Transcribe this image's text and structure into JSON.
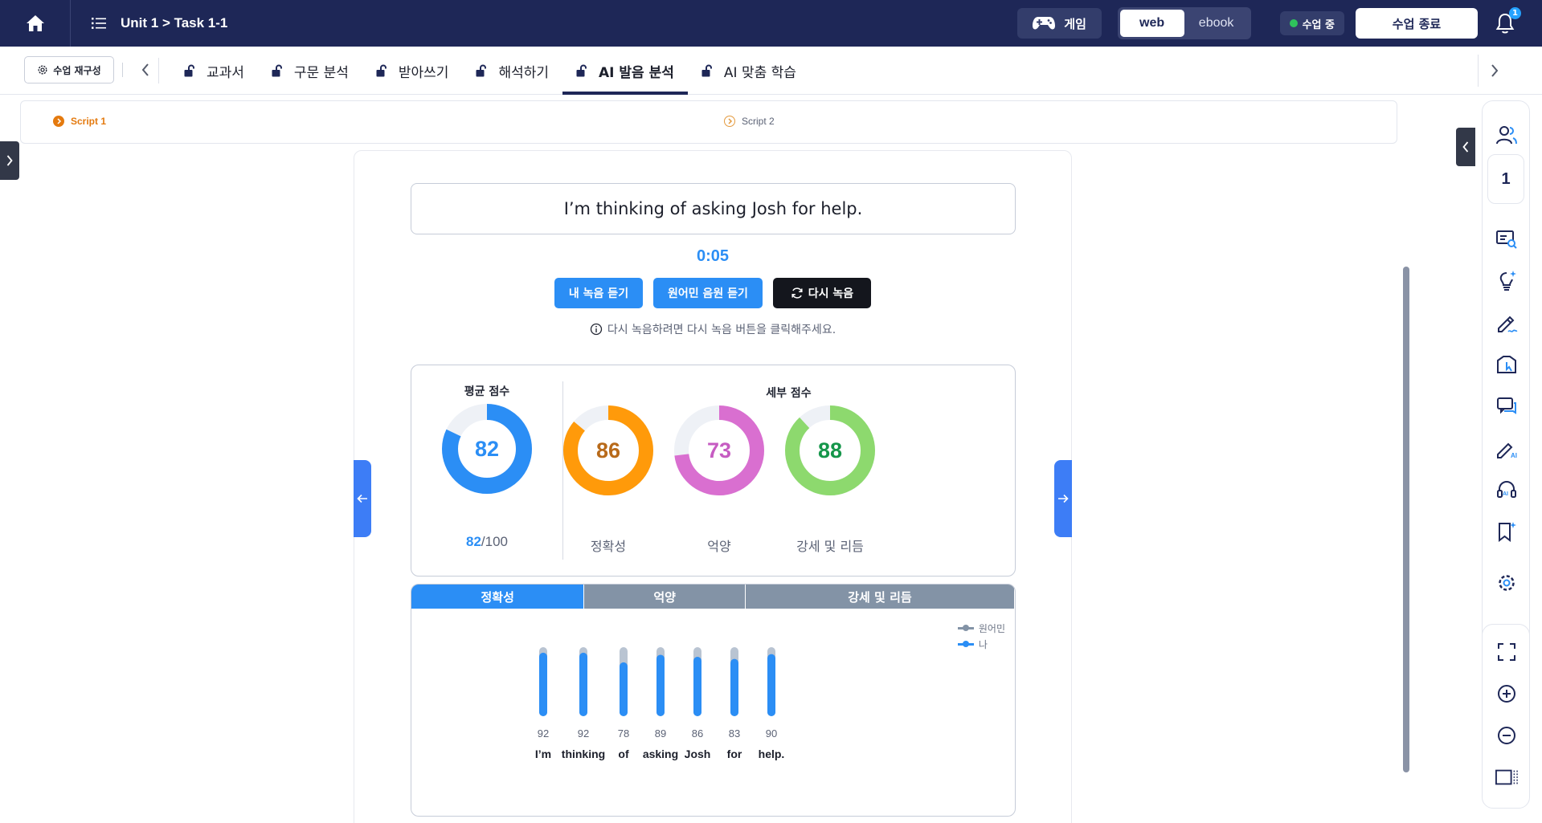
{
  "header": {
    "breadcrumb": "Unit 1 > Task 1-1",
    "game_label": "게임",
    "view_toggle": [
      "web",
      "ebook"
    ],
    "status": "수업 중",
    "end_label": "수업 종료",
    "notification_count": "1"
  },
  "tabbar": {
    "reconfigure_label": "수업 재구성",
    "tabs": [
      {
        "label": "교과서"
      },
      {
        "label": "구문 분석"
      },
      {
        "label": "받아쓰기"
      },
      {
        "label": "해석하기"
      },
      {
        "label": "AI 발음 분석"
      },
      {
        "label": "AI 맞춤 학습"
      }
    ]
  },
  "scripts": [
    "Script 1",
    "Script 2"
  ],
  "main": {
    "sentence": "I’m thinking of asking Josh for help.",
    "timer": "0:05",
    "buttons": {
      "my_recording": "내 녹음 듣기",
      "native_audio": "원어민 음원 듣기",
      "re_record": "다시 녹음"
    },
    "hint": "다시 녹음하려면 다시 녹음 버튼을 클릭해주세요.",
    "average": {
      "title": "평균 점수",
      "score": "82",
      "score_value": 82,
      "max": "/100",
      "color": "#2b8ef5"
    },
    "detail_title": "세부 점수",
    "details": [
      {
        "label": "정확성",
        "score": "86",
        "value": 86,
        "color": "#ff9a0a",
        "text_color": "#b86a1a"
      },
      {
        "label": "억양",
        "score": "73",
        "value": 73,
        "color": "#d96fd0",
        "text_color": "#c65cc2"
      },
      {
        "label": "강세 및 리듬",
        "score": "88",
        "value": 88,
        "color": "#8dd96e",
        "text_color": "#15964a"
      }
    ],
    "bar_tabs": [
      "정확성",
      "억양",
      "강세 및 리듬"
    ],
    "legend": {
      "native": "원어민",
      "me": "나"
    }
  },
  "chart_data": {
    "type": "bar",
    "categories": [
      "I’m",
      "thinking",
      "of",
      "asking",
      "Josh",
      "for",
      "help."
    ],
    "series": [
      {
        "name": "원어민",
        "values": [
          100,
          100,
          100,
          100,
          100,
          100,
          100
        ]
      },
      {
        "name": "나",
        "values": [
          92,
          92,
          78,
          89,
          86,
          83,
          90
        ]
      }
    ],
    "value_labels": [
      "92",
      "92",
      "78",
      "89",
      "86",
      "83",
      "90"
    ],
    "ylim": [
      0,
      100
    ],
    "colors": {
      "native": "#b9c4d2",
      "me": "#2b8ef5"
    }
  }
}
